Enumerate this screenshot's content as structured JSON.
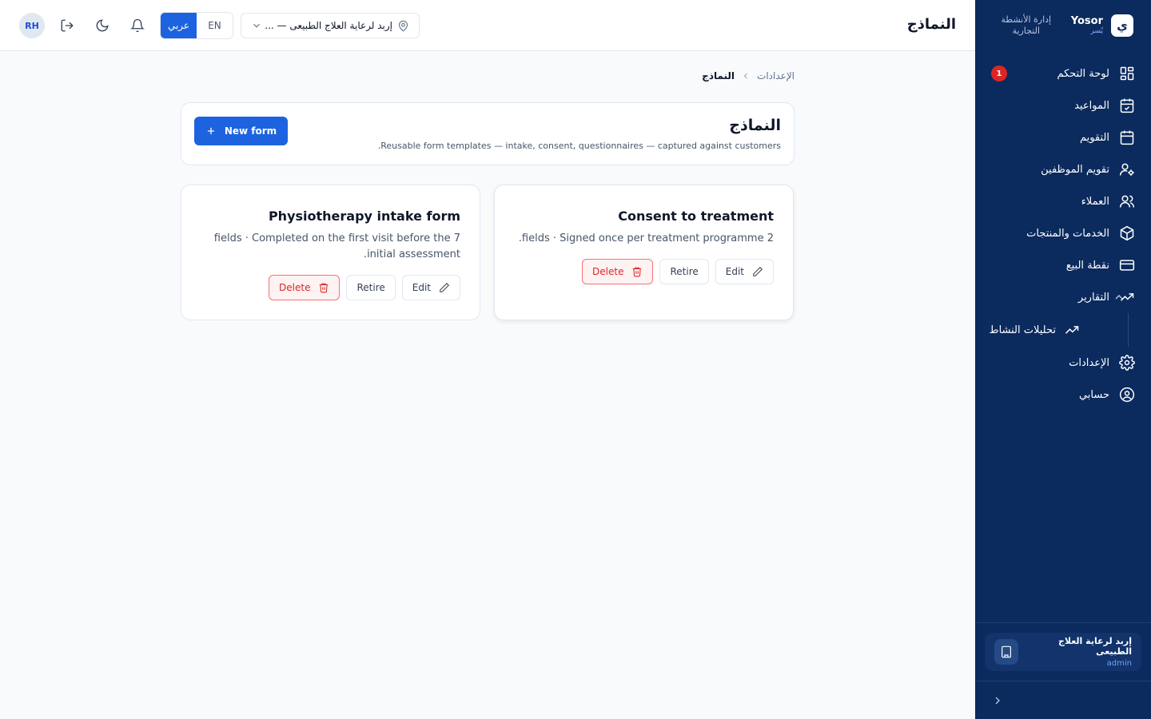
{
  "brand": {
    "name": "Yosor",
    "sub": "يُسر",
    "tagline": "إدارة الأنشطة التجارية",
    "logo_letter": "ي"
  },
  "header": {
    "title": "النماذج",
    "branch": "إربد لرعاية العلاج الطبيعى — ...",
    "lang_en": "EN",
    "lang_ar": "عربي",
    "avatar": "RH"
  },
  "sidebar": {
    "items": [
      {
        "label": "لوحة التحكم",
        "icon": "dashboard-icon",
        "badge": "1"
      },
      {
        "label": "المواعيد",
        "icon": "calendar-check-icon"
      },
      {
        "label": "التقويم",
        "icon": "calendar-icon"
      },
      {
        "label": "تقويم الموظفين",
        "icon": "user-cog-icon"
      },
      {
        "label": "العملاء",
        "icon": "users-icon"
      },
      {
        "label": "الخدمات والمنتجات",
        "icon": "package-icon"
      },
      {
        "label": "نقطة البيع",
        "icon": "credit-card-icon"
      },
      {
        "label": "التقارير",
        "icon": "trending-up-icon"
      }
    ],
    "sub_items": [
      {
        "label": "تحليلات النشاط",
        "icon": "trending-up-icon"
      }
    ],
    "bottom_items": [
      {
        "label": "الإعدادات",
        "icon": "gear-icon"
      },
      {
        "label": "حسابي",
        "icon": "user-circle-icon"
      }
    ],
    "org": {
      "name": "إربد لرعاية العلاج الطبيعى",
      "role": "admin"
    }
  },
  "breadcrumb": {
    "parent": "الإعدادات",
    "current": "النماذج"
  },
  "hero": {
    "title": "النماذج",
    "subtitle": "Reusable form templates — intake, consent, questionnaires — captured against customers.",
    "new_button": "New form"
  },
  "cards": [
    {
      "title": "Consent to treatment",
      "description": "2 fields · Signed once per treatment programme.",
      "edit": "Edit",
      "retire": "Retire",
      "delete": "Delete"
    },
    {
      "title": "Physiotherapy intake form",
      "description": "7 fields · Completed on the first visit before the initial assessment.",
      "edit": "Edit",
      "retire": "Retire",
      "delete": "Delete"
    }
  ],
  "colors": {
    "sidebar": "#0b2a5e",
    "accent": "#1d63e0",
    "danger": "#dc2626"
  }
}
